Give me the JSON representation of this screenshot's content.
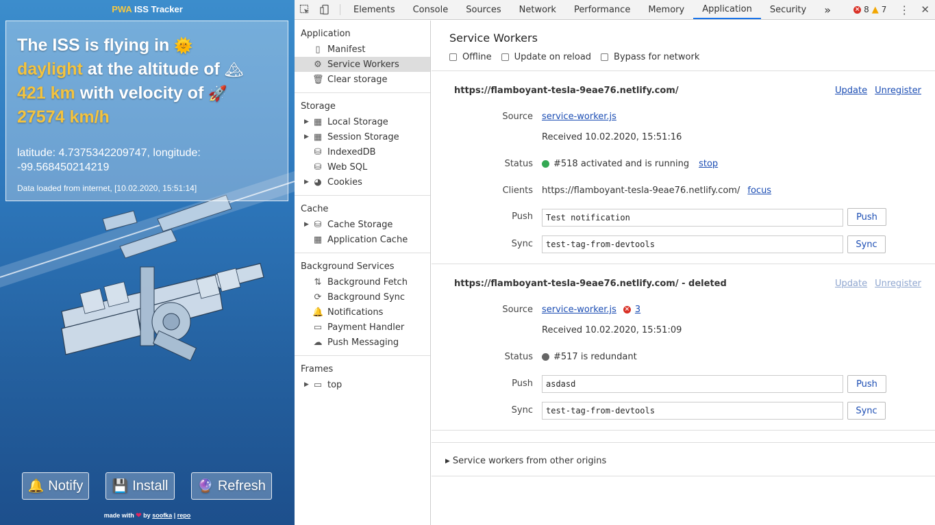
{
  "app": {
    "header": {
      "pwa": "PWA",
      "title": "ISS Tracker"
    },
    "headline": {
      "p1": "The ISS is flying in",
      "emoji_sun": "🌞",
      "daylight": "daylight",
      "p2": "at the altitude of",
      "emoji_mountain": "🏔",
      "altitude": "421 km",
      "p3": "with velocity of",
      "emoji_rocket": "🚀",
      "velocity": "27574 km/h"
    },
    "coords": "latitude: 4.7375342209747, longitude: -99.568450214219",
    "loaded": "Data loaded from internet, [10.02.2020, 15:51:14]",
    "buttons": {
      "notify": {
        "label": "Notify",
        "icon": "🔔"
      },
      "install": {
        "label": "Install",
        "icon": "💾"
      },
      "refresh": {
        "label": "Refresh",
        "icon": "🔮"
      }
    },
    "footer": {
      "made_with": "made with",
      "heart": "❤",
      "by": "by",
      "author": "soofka",
      "sep": "|",
      "repo": "repo"
    }
  },
  "devtools": {
    "tabs": [
      "Elements",
      "Console",
      "Sources",
      "Network",
      "Performance",
      "Memory",
      "Application",
      "Security"
    ],
    "active_tab": "Application",
    "more": "»",
    "errors": "8",
    "warnings": "7",
    "sidebar": {
      "application": {
        "title": "Application",
        "items": [
          "Manifest",
          "Service Workers",
          "Clear storage"
        ]
      },
      "storage": {
        "title": "Storage",
        "items": [
          "Local Storage",
          "Session Storage",
          "IndexedDB",
          "Web SQL",
          "Cookies"
        ]
      },
      "cache": {
        "title": "Cache",
        "items": [
          "Cache Storage",
          "Application Cache"
        ]
      },
      "background": {
        "title": "Background Services",
        "items": [
          "Background Fetch",
          "Background Sync",
          "Notifications",
          "Payment Handler",
          "Push Messaging"
        ]
      },
      "frames": {
        "title": "Frames",
        "items": [
          "top"
        ]
      }
    },
    "main": {
      "title": "Service Workers",
      "options": [
        "Offline",
        "Update on reload",
        "Bypass for network"
      ],
      "worker1": {
        "origin": "https://flamboyant-tesla-9eae76.netlify.com/",
        "update": "Update",
        "unregister": "Unregister",
        "labels": {
          "source": "Source",
          "status": "Status",
          "clients": "Clients",
          "push": "Push",
          "sync": "Sync"
        },
        "source": "service-worker.js",
        "received": "Received 10.02.2020, 15:51:16",
        "status_text": "#518 activated and is running",
        "status_color": "#34a853",
        "stop": "stop",
        "client": "https://flamboyant-tesla-9eae76.netlify.com/",
        "focus": "focus",
        "push_value": "Test notification",
        "sync_value": "test-tag-from-devtools",
        "push_btn": "Push",
        "sync_btn": "Sync"
      },
      "worker2": {
        "origin": "https://flamboyant-tesla-9eae76.netlify.com/",
        "deleted": "- deleted",
        "update": "Update",
        "unregister": "Unregister",
        "labels": {
          "source": "Source",
          "status": "Status",
          "push": "Push",
          "sync": "Sync"
        },
        "source": "service-worker.js",
        "error_count": "3",
        "received": "Received 10.02.2020, 15:51:09",
        "status_text": "#517 is redundant",
        "status_color": "#666666",
        "push_value": "asdasd",
        "sync_value": "test-tag-from-devtools",
        "push_btn": "Push",
        "sync_btn": "Sync"
      },
      "other_origins": "Service workers from other origins"
    }
  }
}
